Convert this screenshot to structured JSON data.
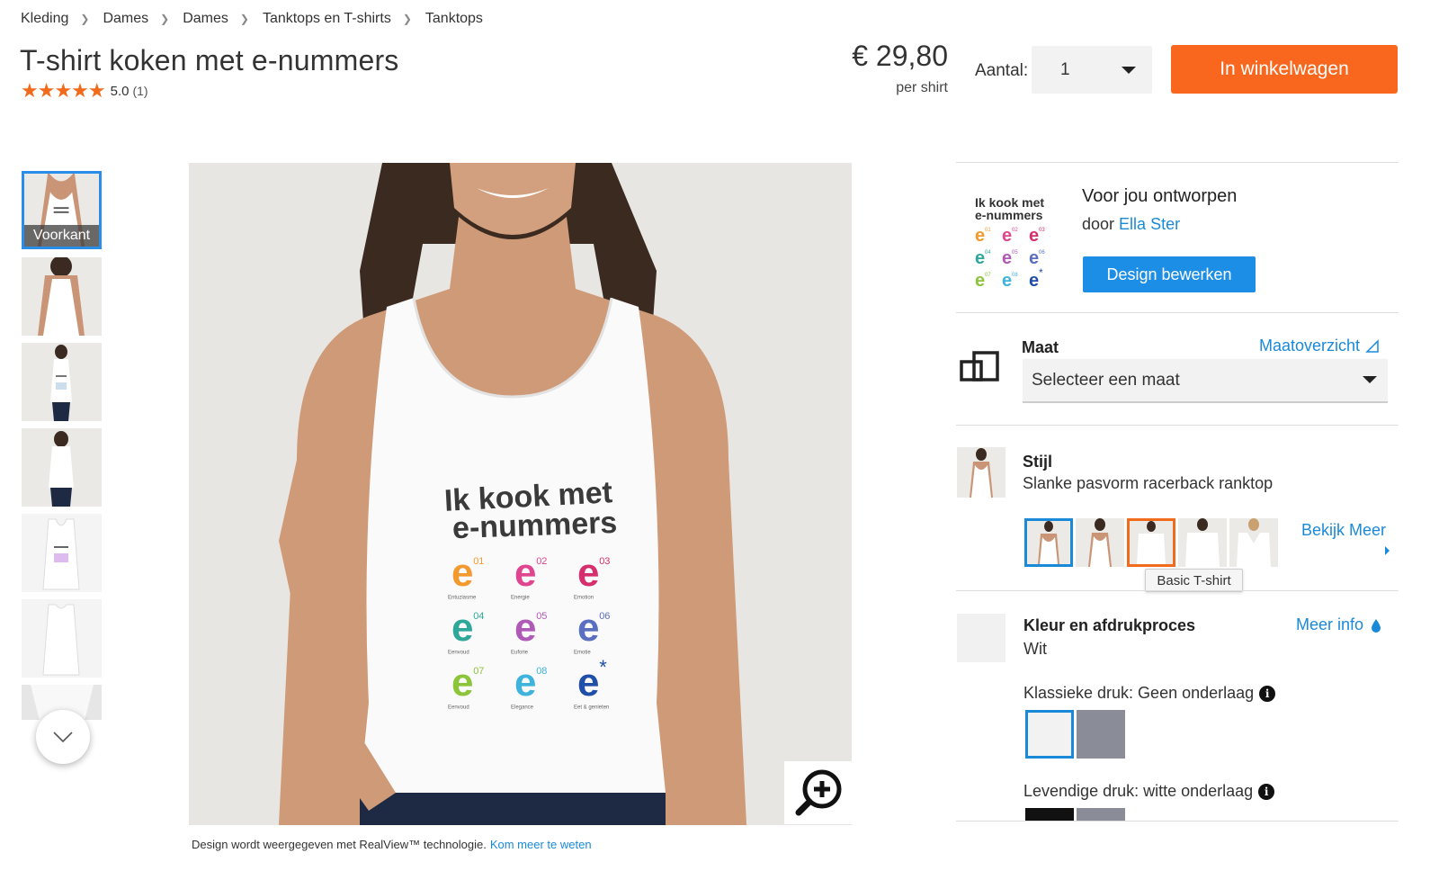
{
  "breadcrumb": [
    "Kleding",
    "Dames",
    "Dames",
    "Tanktops en T-shirts",
    "Tanktops"
  ],
  "product": {
    "title": "T-shirt koken met e-nummers",
    "rating_stars": "★★★★★",
    "rating_value": "5.0",
    "rating_count": "(1)",
    "price": "€ 29,80",
    "price_unit": "per shirt"
  },
  "purchase": {
    "qty_label": "Aantal:",
    "qty_value": "1",
    "cart_button": "In winkelwagen"
  },
  "gallery": {
    "active_caption": "Voorkant",
    "realview_note": "Design wordt weergegeven met RealView™ technologie.",
    "realview_link": "Kom meer te weten"
  },
  "shirt_print": {
    "line1": "Ik kook met",
    "line2": "e-nummers",
    "items": [
      {
        "n": "01",
        "label": "Entuziasme",
        "color": "#f29a2e"
      },
      {
        "n": "02",
        "label": "Energie",
        "color": "#e0458f"
      },
      {
        "n": "03",
        "label": "Emotion",
        "color": "#d62f6e"
      },
      {
        "n": "04",
        "label": "Eenvoud",
        "color": "#2fa89a"
      },
      {
        "n": "05",
        "label": "Euforie",
        "color": "#b05ab8"
      },
      {
        "n": "06",
        "label": "Emotie",
        "color": "#5a6fbf"
      },
      {
        "n": "07",
        "label": "Eenvoud",
        "color": "#8cc43a"
      },
      {
        "n": "08",
        "label": "Elegance",
        "color": "#3fb3dc"
      },
      {
        "n": "*",
        "label": "Eet & genieten",
        "color": "#1f4fa8"
      }
    ]
  },
  "design": {
    "title": "Voor jou ontworpen",
    "by_prefix": "door",
    "designer": "Ella Ster",
    "edit_button": "Design bewerken",
    "thumb_line1": "Ik kook met",
    "thumb_line2": "e-nummers"
  },
  "size": {
    "label": "Maat",
    "chart_link": "Maatoverzicht",
    "placeholder": "Selecteer een maat"
  },
  "style": {
    "label": "Stijl",
    "value": "Slanke pasvorm racerback ranktop",
    "view_more": "Bekijk Meer",
    "tooltip": "Basic T-shirt"
  },
  "color": {
    "label": "Kleur en afdrukproces",
    "value": "Wit",
    "more_info": "Meer info",
    "classic_print": "Klassieke druk: Geen onderlaag",
    "vivid_print": "Levendige druk: witte onderlaag"
  },
  "colors": {
    "accent_orange": "#f9671e",
    "accent_blue": "#1d8ee6",
    "swatch_white": "#f2f2f2",
    "swatch_grey": "#8a8d97",
    "swatch_black": "#111111"
  }
}
